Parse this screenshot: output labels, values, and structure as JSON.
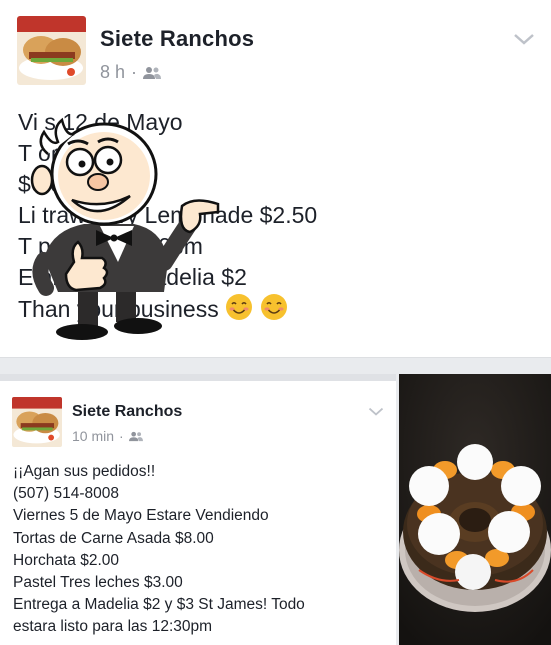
{
  "post1": {
    "page_name": "Siete Ranchos",
    "time": "8 h",
    "separator": "·",
    "audience_icon": "friends-icon",
    "lines": [
      "Vi      s 12 de Mayo",
      "T            or 6 x $10",
      "              $6.00",
      "Li                 trawberry Lemonade $2.50",
      "T                 para las 3:30pm",
      "E                  ames $3 Madelia $2",
      "Than          your business"
    ],
    "emoji": "smiling-face-emoji"
  },
  "post2": {
    "page_name": "Siete Ranchos",
    "time": "10 min",
    "separator": "·",
    "audience_icon": "friends-icon",
    "lines": [
      "¡¡Agan sus pedidos!!",
      "(507) 514-8008",
      "Viernes 5 de Mayo Estare Vendiendo",
      "Tortas de Carne Asada $8.00",
      "Horchata $2.00",
      "Pastel Tres leches $3.00",
      "Entrega a Madelia $2 y $3 St James! Todo",
      "estara listo para las 12:30pm"
    ]
  },
  "sticker": "thumbs-up-pointing-cartoon-man",
  "photo": "tres-leches-cake-with-peaches",
  "colors": {
    "text": "#1d2129",
    "meta": "#90949c",
    "feed_background": "#e9ebee"
  }
}
